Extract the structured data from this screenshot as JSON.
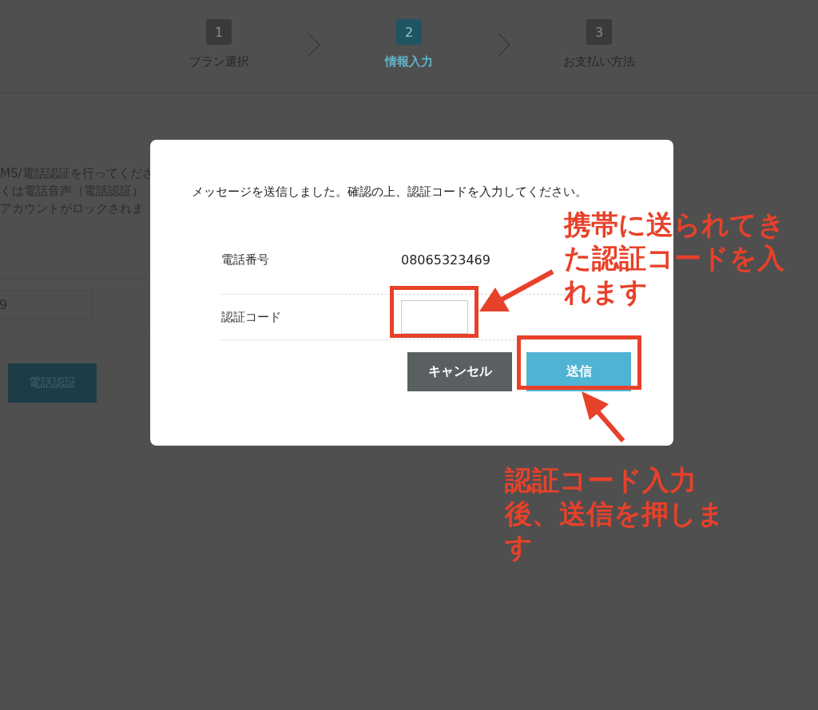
{
  "steps": [
    {
      "number": "1",
      "label": "プラン選択",
      "selected": false
    },
    {
      "number": "2",
      "label": "情報入力",
      "selected": true
    },
    {
      "number": "3",
      "label": "お支払い方法",
      "selected": false
    }
  ],
  "background": {
    "lines": [
      "MS/電話認証を行ってくださ",
      "くは電話音声（電話認証）",
      "アカウントがロックされま"
    ],
    "phone_value": "9",
    "button": "電話認証"
  },
  "modal": {
    "message": "メッセージを送信しました。確認の上、認証コードを入力してください。",
    "rows": [
      {
        "kind": "text",
        "label": "電話番号",
        "value": "08065323469"
      },
      {
        "kind": "input",
        "label": "認証コード",
        "value": ""
      }
    ],
    "buttons": [
      {
        "kind": "cancel",
        "label": "キャンセル"
      },
      {
        "kind": "submit",
        "label": "送信"
      }
    ]
  },
  "annotations": [
    "携帯に送られてきた認証コードを入れます",
    "認証コード入力後、送信を押します"
  ]
}
